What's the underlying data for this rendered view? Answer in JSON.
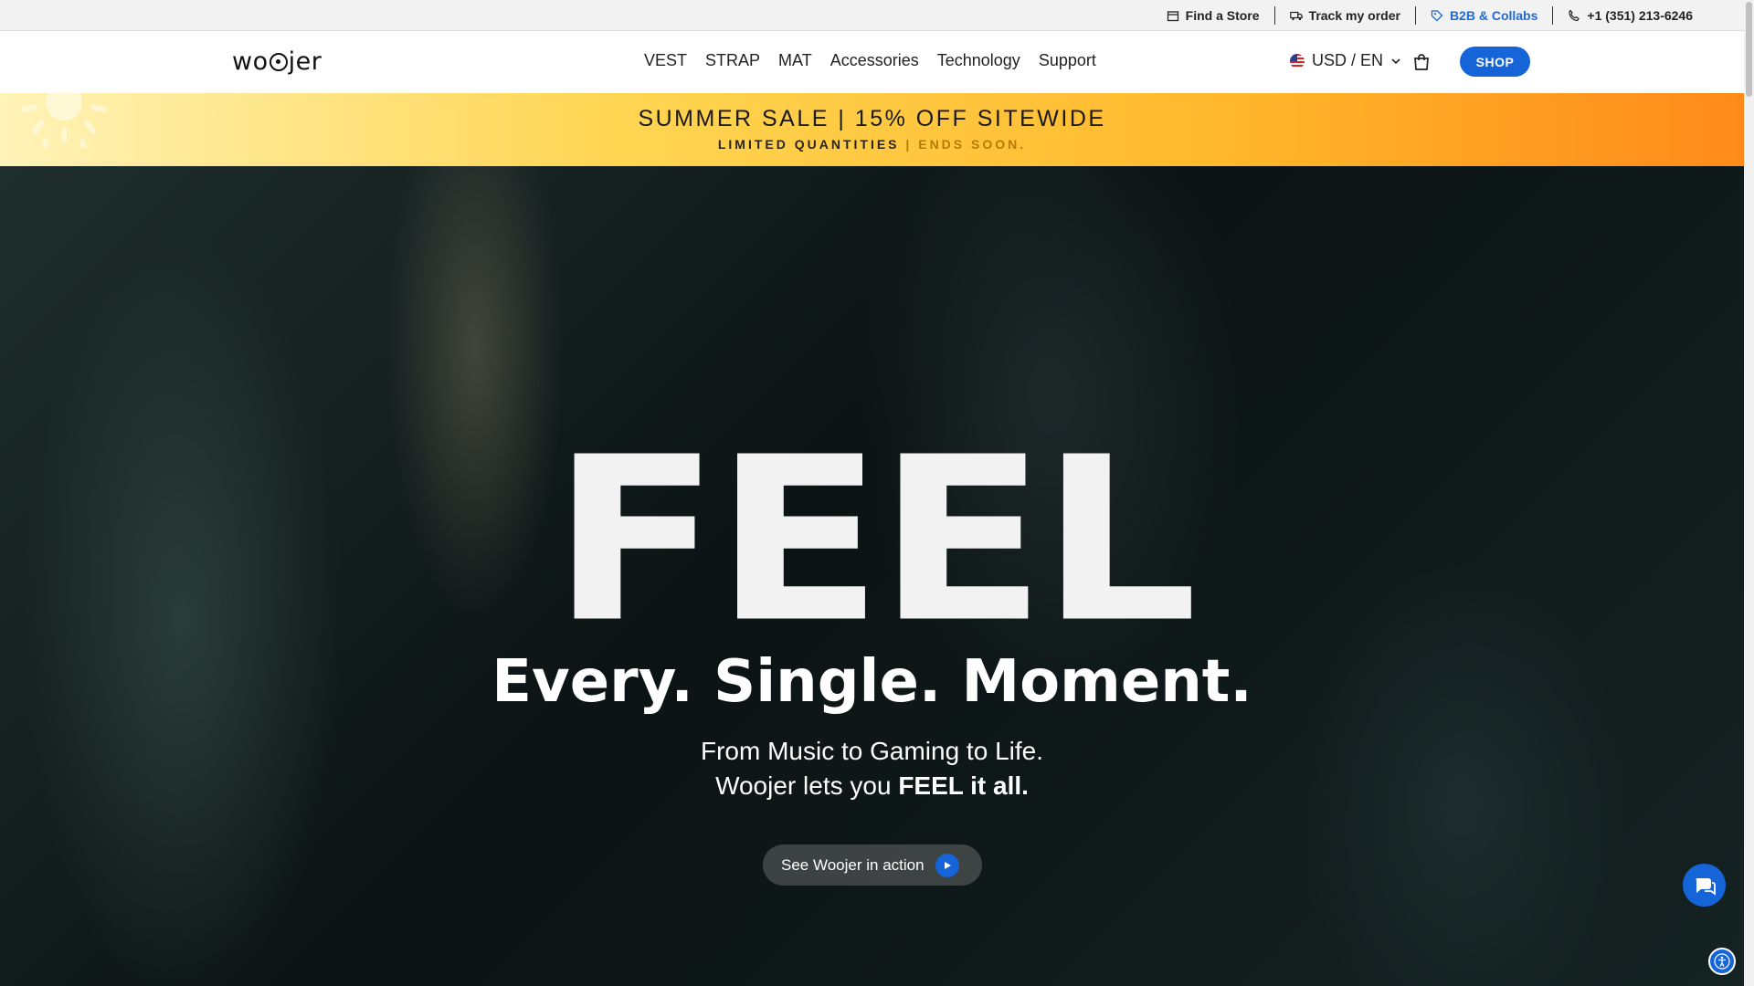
{
  "utility": {
    "find_store": "Find a Store",
    "track_order": "Track my order",
    "b2b": "B2B & Collabs",
    "phone": "+1 (351) 213-6246"
  },
  "header": {
    "logo_pre": "wo",
    "logo_post": "jer",
    "nav": [
      "VEST",
      "STRAP",
      "MAT",
      "Accessories",
      "Technology",
      "Support"
    ],
    "locale": "USD / EN",
    "shop_label": "SHOP"
  },
  "banner": {
    "title": "SUMMER SALE | 15% OFF SITEWIDE",
    "sub_a": "LIMITED QUANTITIES",
    "sub_sep": " | ",
    "sub_b": "ENDS SOON."
  },
  "hero": {
    "big_word": "FEEL",
    "headline": "Every. Single. Moment.",
    "line1": "From Music to Gaming to Life.",
    "line2_pre": "Woojer lets you ",
    "line2_bold": "FEEL it all.",
    "cta": "See Woojer in action"
  },
  "colors": {
    "accent": "#1565d8",
    "banner_start": "#fff3b8",
    "banner_end": "#ff8a1a"
  }
}
